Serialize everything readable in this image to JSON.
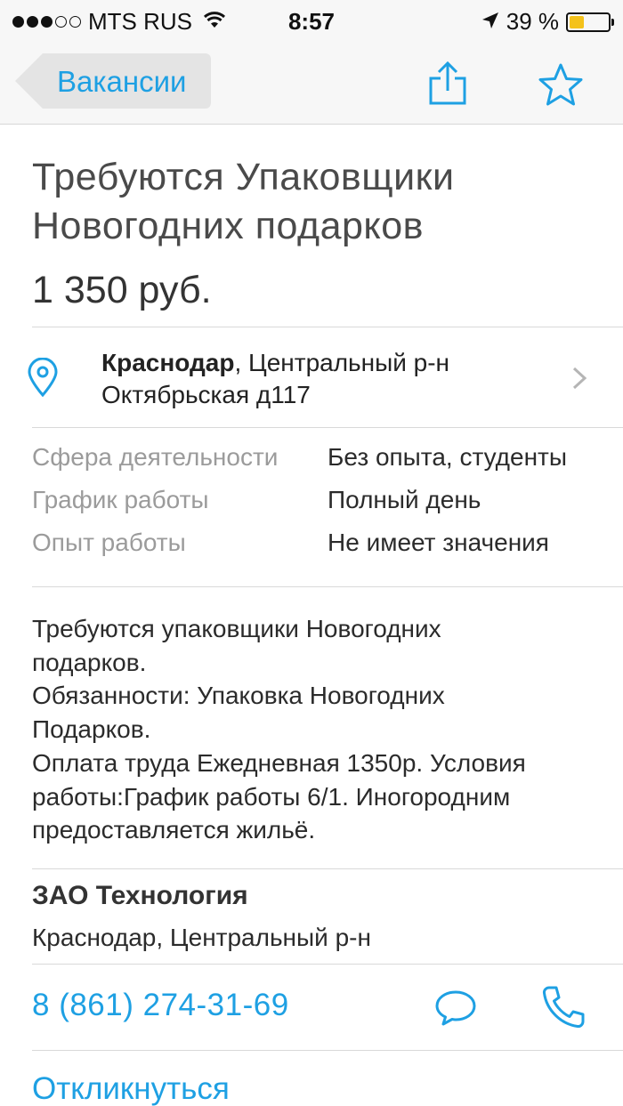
{
  "status_bar": {
    "carrier": "MTS RUS",
    "time": "8:57",
    "battery_percent": "39 %",
    "battery_level": 0.39,
    "signal_strength": 3,
    "signal_max": 5
  },
  "nav": {
    "back_label": "Вакансии",
    "icons": [
      "share-icon",
      "star-icon"
    ]
  },
  "vacancy": {
    "title": "Требуются Упаковщики Новогодних подарков",
    "price": "1 350 руб."
  },
  "address": {
    "city": "Краснодар",
    "district": ", Центральный р-н",
    "street": "Октябрьская д117"
  },
  "details": [
    {
      "key": "Сфера деятельности",
      "value": "Без опыта, студенты"
    },
    {
      "key": "График работы",
      "value": "Полный день"
    },
    {
      "key": "Опыт работы",
      "value": "Не имеет значения"
    }
  ],
  "description_lines": [
    "Требуются упаковщики Новогодних",
    "подарков.",
    "Обязанности: Упаковка Новогодних",
    "Подарков.",
    "Оплата труда Ежедневная 1350р. Условия",
    "работы:График работы 6/1. Иногородним",
    "предоставляется жильё."
  ],
  "company": {
    "name": "ЗАО Технология",
    "location": "Краснодар, Центральный р-н"
  },
  "contact": {
    "phone": "8 (861) 274-31-69"
  },
  "actions": {
    "respond_label": "Откликнуться"
  },
  "colors": {
    "accent": "#1ea0e3",
    "battery": "#f4c21b",
    "nav_bg": "#f7f7f7"
  }
}
